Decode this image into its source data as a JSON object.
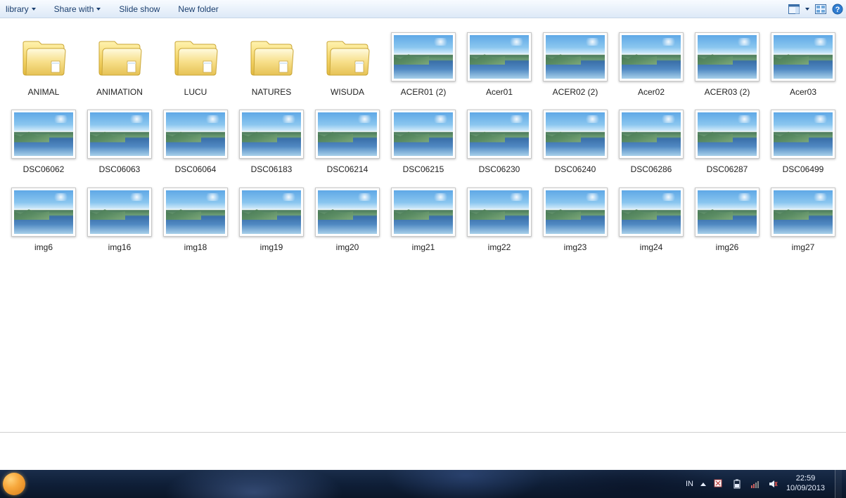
{
  "toolbar": {
    "library_label": "library",
    "share_label": "Share with",
    "slideshow_label": "Slide show",
    "newfolder_label": "New folder"
  },
  "items": [
    {
      "type": "folder",
      "name": "ANIMAL"
    },
    {
      "type": "folder",
      "name": "ANIMATION"
    },
    {
      "type": "folder",
      "name": "LUCU"
    },
    {
      "type": "folder",
      "name": "NATURES"
    },
    {
      "type": "folder",
      "name": "WISUDA"
    },
    {
      "type": "image",
      "name": "ACER01 (2)"
    },
    {
      "type": "image",
      "name": "Acer01"
    },
    {
      "type": "image",
      "name": "ACER02 (2)"
    },
    {
      "type": "image",
      "name": "Acer02"
    },
    {
      "type": "image",
      "name": "ACER03 (2)"
    },
    {
      "type": "image",
      "name": "Acer03"
    },
    {
      "type": "image",
      "name": "DSC06062"
    },
    {
      "type": "image",
      "name": "DSC06063"
    },
    {
      "type": "image",
      "name": "DSC06064"
    },
    {
      "type": "image",
      "name": "DSC06183"
    },
    {
      "type": "image",
      "name": "DSC06214"
    },
    {
      "type": "image",
      "name": "DSC06215"
    },
    {
      "type": "image",
      "name": "DSC06230"
    },
    {
      "type": "image",
      "name": "DSC06240"
    },
    {
      "type": "image",
      "name": "DSC06286"
    },
    {
      "type": "image",
      "name": "DSC06287"
    },
    {
      "type": "image",
      "name": "DSC06499"
    },
    {
      "type": "image",
      "name": "img6"
    },
    {
      "type": "image",
      "name": "img16"
    },
    {
      "type": "image",
      "name": "img18"
    },
    {
      "type": "image",
      "name": "img19"
    },
    {
      "type": "image",
      "name": "img20"
    },
    {
      "type": "image",
      "name": "img21"
    },
    {
      "type": "image",
      "name": "img22"
    },
    {
      "type": "image",
      "name": "img23"
    },
    {
      "type": "image",
      "name": "img24"
    },
    {
      "type": "image",
      "name": "img26"
    },
    {
      "type": "image",
      "name": "img27"
    }
  ],
  "tray": {
    "lang": "IN",
    "time": "22:59",
    "date": "10/09/2013"
  }
}
